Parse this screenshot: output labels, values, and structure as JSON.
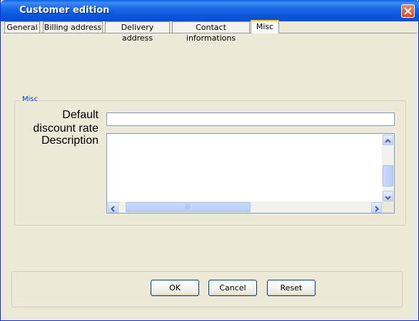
{
  "window": {
    "title": "Customer edition"
  },
  "tabs": [
    {
      "label": "General"
    },
    {
      "label": "Billing address"
    },
    {
      "label": "Delivery address"
    },
    {
      "label": "Contact informations"
    },
    {
      "label": "Misc",
      "active": true
    }
  ],
  "misc": {
    "group_title": "Misc",
    "discount_label_line1": "Default",
    "discount_label_line2": "discount rate",
    "discount_value": "",
    "description_label": "Description",
    "description_value": ""
  },
  "buttons": {
    "ok": "OK",
    "cancel": "Cancel",
    "reset": "Reset"
  },
  "colors": {
    "titlebar": "#0A5FE0",
    "accent": "#FFC83C",
    "group_title": "#0046D5"
  }
}
